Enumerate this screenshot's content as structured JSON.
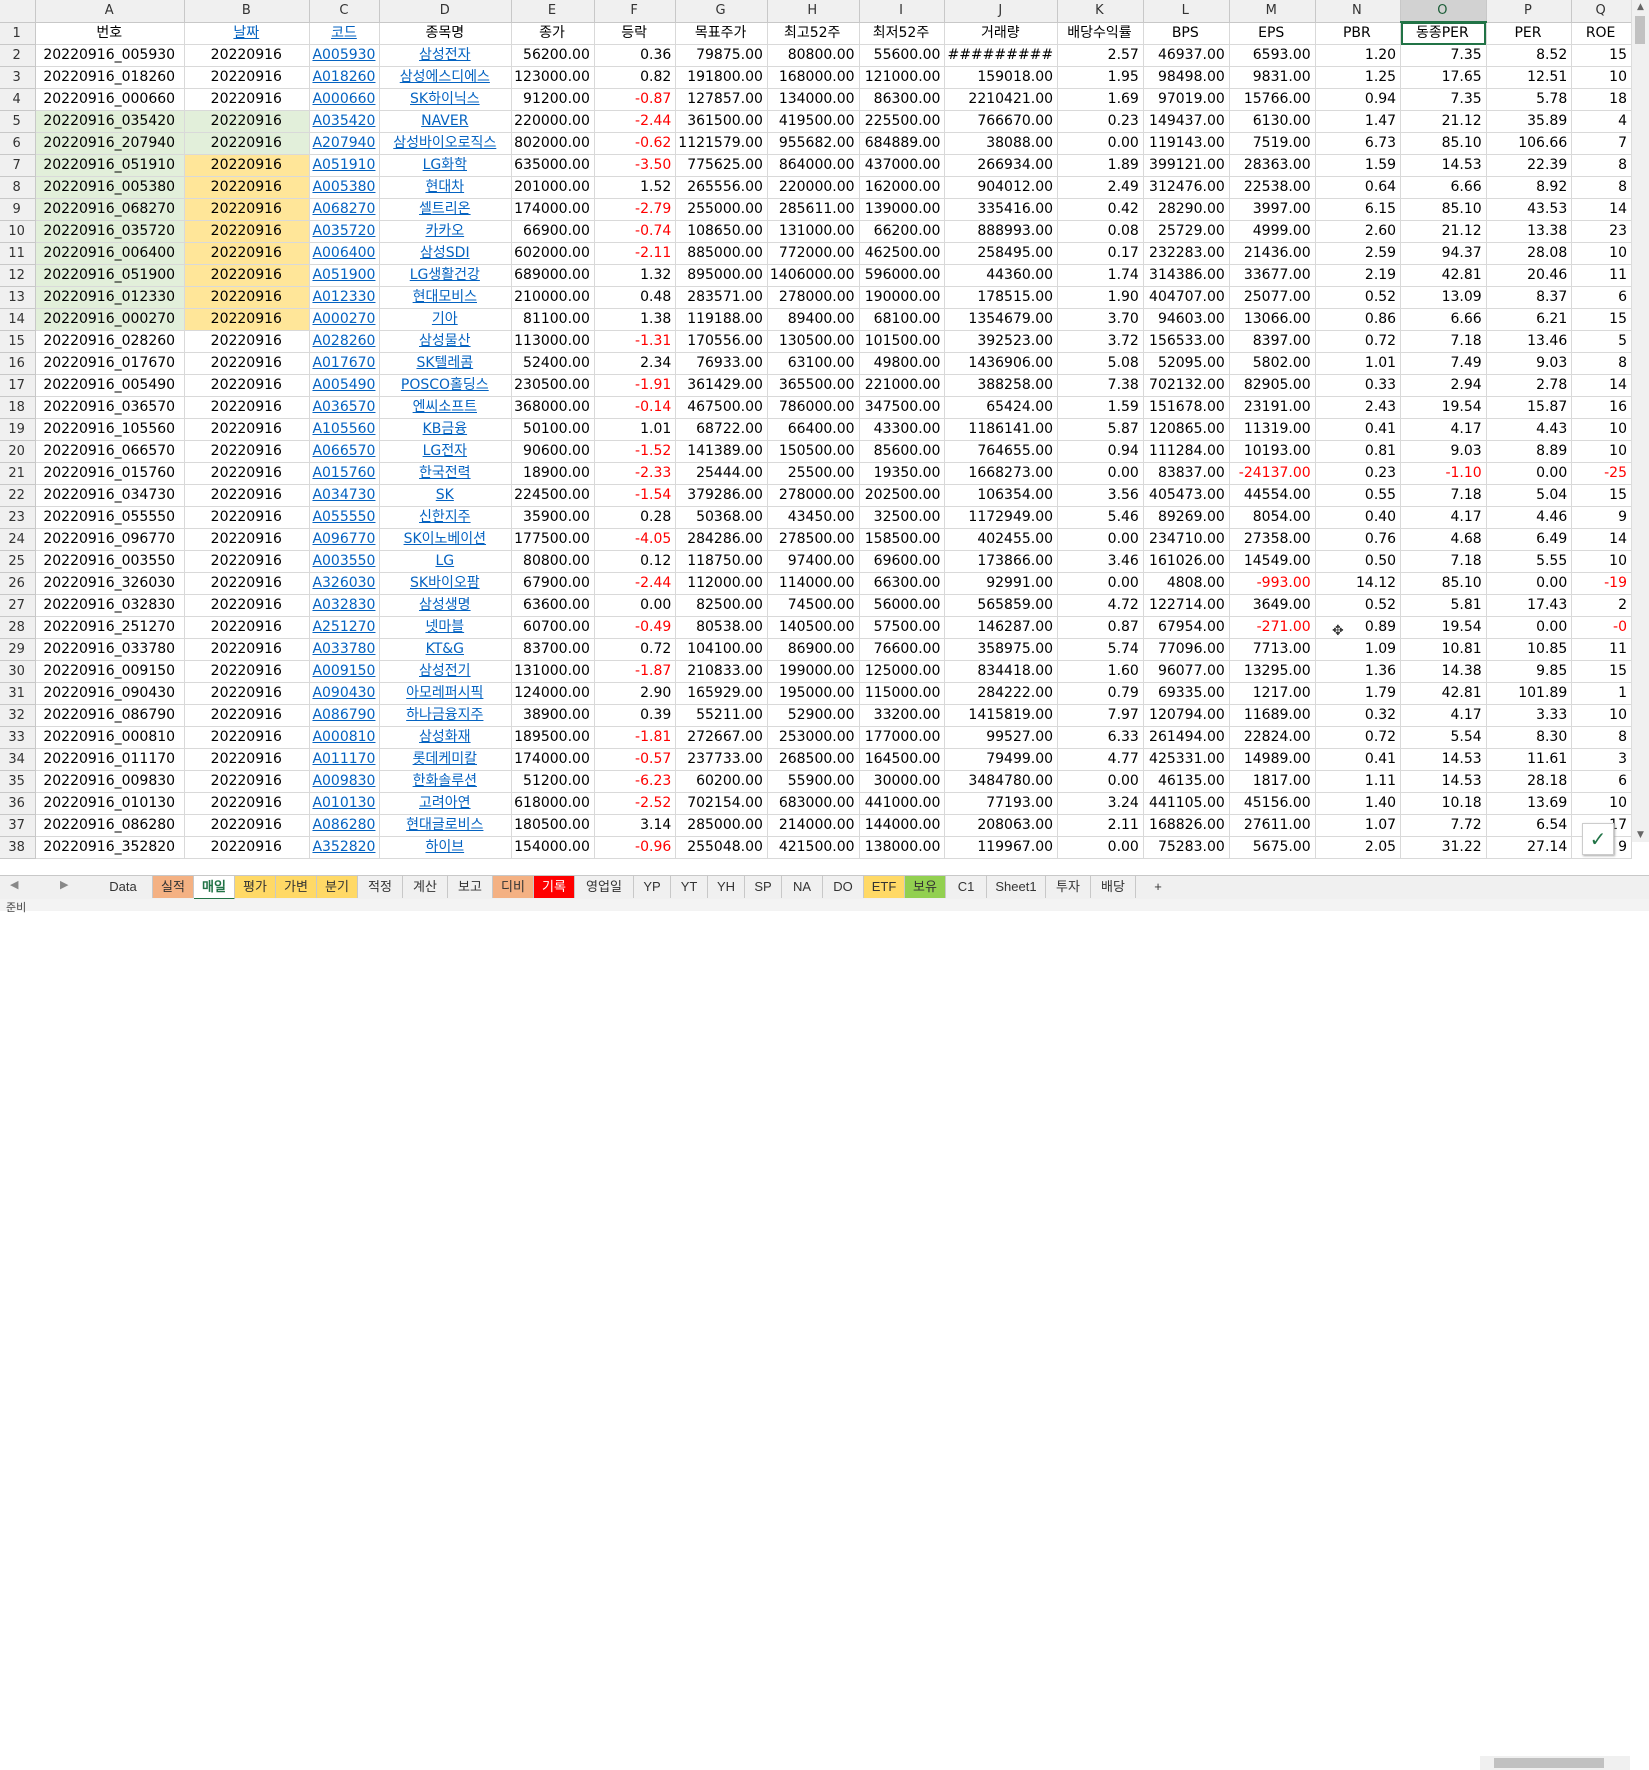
{
  "columns": [
    "A",
    "B",
    "C",
    "D",
    "E",
    "F",
    "G",
    "H",
    "I",
    "J",
    "K",
    "L",
    "M",
    "N",
    "O",
    "P",
    "Q"
  ],
  "header": [
    "번호",
    "날짜",
    "코드",
    "종목명",
    "종가",
    "등락",
    "목표주가",
    "최고52주",
    "최저52주",
    "거래량",
    "배당수익률",
    "BPS",
    "EPS",
    "PBR",
    "동종PER",
    "PER",
    "ROE"
  ],
  "rows": [
    [
      "20220916_005930",
      "20220916",
      "A005930",
      "삼성전자",
      "56200.00",
      "0.36",
      "79875.00",
      "80800.00",
      "55600.00",
      "#########",
      "2.57",
      "46937.00",
      "6593.00",
      "1.20",
      "7.35",
      "8.52",
      "15"
    ],
    [
      "20220916_018260",
      "20220916",
      "A018260",
      "삼성에스디에스",
      "123000.00",
      "0.82",
      "191800.00",
      "168000.00",
      "121000.00",
      "159018.00",
      "1.95",
      "98498.00",
      "9831.00",
      "1.25",
      "17.65",
      "12.51",
      "10"
    ],
    [
      "20220916_000660",
      "20220916",
      "A000660",
      "SK하이닉스",
      "91200.00",
      "-0.87",
      "127857.00",
      "134000.00",
      "86300.00",
      "2210421.00",
      "1.69",
      "97019.00",
      "15766.00",
      "0.94",
      "7.35",
      "5.78",
      "18"
    ],
    [
      "20220916_035420",
      "20220916",
      "A035420",
      "NAVER",
      "220000.00",
      "-2.44",
      "361500.00",
      "419500.00",
      "225500.00",
      "766670.00",
      "0.23",
      "149437.00",
      "6130.00",
      "1.47",
      "21.12",
      "35.89",
      "4"
    ],
    [
      "20220916_207940",
      "20220916",
      "A207940",
      "삼성바이오로직스",
      "802000.00",
      "-0.62",
      "1121579.00",
      "955682.00",
      "684889.00",
      "38088.00",
      "0.00",
      "119143.00",
      "7519.00",
      "6.73",
      "85.10",
      "106.66",
      "7"
    ],
    [
      "20220916_051910",
      "20220916",
      "A051910",
      "LG화학",
      "635000.00",
      "-3.50",
      "775625.00",
      "864000.00",
      "437000.00",
      "266934.00",
      "1.89",
      "399121.00",
      "28363.00",
      "1.59",
      "14.53",
      "22.39",
      "8"
    ],
    [
      "20220916_005380",
      "20220916",
      "A005380",
      "현대차",
      "201000.00",
      "1.52",
      "265556.00",
      "220000.00",
      "162000.00",
      "904012.00",
      "2.49",
      "312476.00",
      "22538.00",
      "0.64",
      "6.66",
      "8.92",
      "8"
    ],
    [
      "20220916_068270",
      "20220916",
      "A068270",
      "셀트리온",
      "174000.00",
      "-2.79",
      "255000.00",
      "285611.00",
      "139000.00",
      "335416.00",
      "0.42",
      "28290.00",
      "3997.00",
      "6.15",
      "85.10",
      "43.53",
      "14"
    ],
    [
      "20220916_035720",
      "20220916",
      "A035720",
      "카카오",
      "66900.00",
      "-0.74",
      "108650.00",
      "131000.00",
      "66200.00",
      "888993.00",
      "0.08",
      "25729.00",
      "4999.00",
      "2.60",
      "21.12",
      "13.38",
      "23"
    ],
    [
      "20220916_006400",
      "20220916",
      "A006400",
      "삼성SDI",
      "602000.00",
      "-2.11",
      "885000.00",
      "772000.00",
      "462500.00",
      "258495.00",
      "0.17",
      "232283.00",
      "21436.00",
      "2.59",
      "94.37",
      "28.08",
      "10"
    ],
    [
      "20220916_051900",
      "20220916",
      "A051900",
      "LG생활건강",
      "689000.00",
      "1.32",
      "895000.00",
      "1406000.00",
      "596000.00",
      "44360.00",
      "1.74",
      "314386.00",
      "33677.00",
      "2.19",
      "42.81",
      "20.46",
      "11"
    ],
    [
      "20220916_012330",
      "20220916",
      "A012330",
      "현대모비스",
      "210000.00",
      "0.48",
      "283571.00",
      "278000.00",
      "190000.00",
      "178515.00",
      "1.90",
      "404707.00",
      "25077.00",
      "0.52",
      "13.09",
      "8.37",
      "6"
    ],
    [
      "20220916_000270",
      "20220916",
      "A000270",
      "기아",
      "81100.00",
      "1.38",
      "119188.00",
      "89400.00",
      "68100.00",
      "1354679.00",
      "3.70",
      "94603.00",
      "13066.00",
      "0.86",
      "6.66",
      "6.21",
      "15"
    ],
    [
      "20220916_028260",
      "20220916",
      "A028260",
      "삼성물산",
      "113000.00",
      "-1.31",
      "170556.00",
      "130500.00",
      "101500.00",
      "392523.00",
      "3.72",
      "156533.00",
      "8397.00",
      "0.72",
      "7.18",
      "13.46",
      "5"
    ],
    [
      "20220916_017670",
      "20220916",
      "A017670",
      "SK텔레콤",
      "52400.00",
      "2.34",
      "76933.00",
      "63100.00",
      "49800.00",
      "1436906.00",
      "5.08",
      "52095.00",
      "5802.00",
      "1.01",
      "7.49",
      "9.03",
      "8"
    ],
    [
      "20220916_005490",
      "20220916",
      "A005490",
      "POSCO홀딩스",
      "230500.00",
      "-1.91",
      "361429.00",
      "365500.00",
      "221000.00",
      "388258.00",
      "7.38",
      "702132.00",
      "82905.00",
      "0.33",
      "2.94",
      "2.78",
      "14"
    ],
    [
      "20220916_036570",
      "20220916",
      "A036570",
      "엔씨소프트",
      "368000.00",
      "-0.14",
      "467500.00",
      "786000.00",
      "347500.00",
      "65424.00",
      "1.59",
      "151678.00",
      "23191.00",
      "2.43",
      "19.54",
      "15.87",
      "16"
    ],
    [
      "20220916_105560",
      "20220916",
      "A105560",
      "KB금융",
      "50100.00",
      "1.01",
      "68722.00",
      "66400.00",
      "43300.00",
      "1186141.00",
      "5.87",
      "120865.00",
      "11319.00",
      "0.41",
      "4.17",
      "4.43",
      "10"
    ],
    [
      "20220916_066570",
      "20220916",
      "A066570",
      "LG전자",
      "90600.00",
      "-1.52",
      "141389.00",
      "150500.00",
      "85600.00",
      "764655.00",
      "0.94",
      "111284.00",
      "10193.00",
      "0.81",
      "9.03",
      "8.89",
      "10"
    ],
    [
      "20220916_015760",
      "20220916",
      "A015760",
      "한국전력",
      "18900.00",
      "-2.33",
      "25444.00",
      "25500.00",
      "19350.00",
      "1668273.00",
      "0.00",
      "83837.00",
      "-24137.00",
      "0.23",
      "-1.10",
      "0.00",
      "-25"
    ],
    [
      "20220916_034730",
      "20220916",
      "A034730",
      "SK",
      "224500.00",
      "-1.54",
      "379286.00",
      "278000.00",
      "202500.00",
      "106354.00",
      "3.56",
      "405473.00",
      "44554.00",
      "0.55",
      "7.18",
      "5.04",
      "15"
    ],
    [
      "20220916_055550",
      "20220916",
      "A055550",
      "신한지주",
      "35900.00",
      "0.28",
      "50368.00",
      "43450.00",
      "32500.00",
      "1172949.00",
      "5.46",
      "89269.00",
      "8054.00",
      "0.40",
      "4.17",
      "4.46",
      "9"
    ],
    [
      "20220916_096770",
      "20220916",
      "A096770",
      "SK이노베이션",
      "177500.00",
      "-4.05",
      "284286.00",
      "278500.00",
      "158500.00",
      "402455.00",
      "0.00",
      "234710.00",
      "27358.00",
      "0.76",
      "4.68",
      "6.49",
      "14"
    ],
    [
      "20220916_003550",
      "20220916",
      "A003550",
      "LG",
      "80800.00",
      "0.12",
      "118750.00",
      "97400.00",
      "69600.00",
      "173866.00",
      "3.46",
      "161026.00",
      "14549.00",
      "0.50",
      "7.18",
      "5.55",
      "10"
    ],
    [
      "20220916_326030",
      "20220916",
      "A326030",
      "SK바이오팜",
      "67900.00",
      "-2.44",
      "112000.00",
      "114000.00",
      "66300.00",
      "92991.00",
      "0.00",
      "4808.00",
      "-993.00",
      "14.12",
      "85.10",
      "0.00",
      "-19"
    ],
    [
      "20220916_032830",
      "20220916",
      "A032830",
      "삼성생명",
      "63600.00",
      "0.00",
      "82500.00",
      "74500.00",
      "56000.00",
      "565859.00",
      "4.72",
      "122714.00",
      "3649.00",
      "0.52",
      "5.81",
      "17.43",
      "2"
    ],
    [
      "20220916_251270",
      "20220916",
      "A251270",
      "넷마블",
      "60700.00",
      "-0.49",
      "80538.00",
      "140500.00",
      "57500.00",
      "146287.00",
      "0.87",
      "67954.00",
      "-271.00",
      "0.89",
      "19.54",
      "0.00",
      "-0"
    ],
    [
      "20220916_033780",
      "20220916",
      "A033780",
      "KT&G",
      "83700.00",
      "0.72",
      "104100.00",
      "86900.00",
      "76600.00",
      "358975.00",
      "5.74",
      "77096.00",
      "7713.00",
      "1.09",
      "10.81",
      "10.85",
      "11"
    ],
    [
      "20220916_009150",
      "20220916",
      "A009150",
      "삼성전기",
      "131000.00",
      "-1.87",
      "210833.00",
      "199000.00",
      "125000.00",
      "834418.00",
      "1.60",
      "96077.00",
      "13295.00",
      "1.36",
      "14.38",
      "9.85",
      "15"
    ],
    [
      "20220916_090430",
      "20220916",
      "A090430",
      "아모레퍼시픽",
      "124000.00",
      "2.90",
      "165929.00",
      "195000.00",
      "115000.00",
      "284222.00",
      "0.79",
      "69335.00",
      "1217.00",
      "1.79",
      "42.81",
      "101.89",
      "1"
    ],
    [
      "20220916_086790",
      "20220916",
      "A086790",
      "하나금융지주",
      "38900.00",
      "0.39",
      "55211.00",
      "52900.00",
      "33200.00",
      "1415819.00",
      "7.97",
      "120794.00",
      "11689.00",
      "0.32",
      "4.17",
      "3.33",
      "10"
    ],
    [
      "20220916_000810",
      "20220916",
      "A000810",
      "삼성화재",
      "189500.00",
      "-1.81",
      "272667.00",
      "253000.00",
      "177000.00",
      "99527.00",
      "6.33",
      "261494.00",
      "22824.00",
      "0.72",
      "5.54",
      "8.30",
      "8"
    ],
    [
      "20220916_011170",
      "20220916",
      "A011170",
      "롯데케미칼",
      "174000.00",
      "-0.57",
      "237733.00",
      "268500.00",
      "164500.00",
      "79499.00",
      "4.77",
      "425331.00",
      "14989.00",
      "0.41",
      "14.53",
      "11.61",
      "3"
    ],
    [
      "20220916_009830",
      "20220916",
      "A009830",
      "한화솔루션",
      "51200.00",
      "-6.23",
      "60200.00",
      "55900.00",
      "30000.00",
      "3484780.00",
      "0.00",
      "46135.00",
      "1817.00",
      "1.11",
      "14.53",
      "28.18",
      "6"
    ],
    [
      "20220916_010130",
      "20220916",
      "A010130",
      "고려아연",
      "618000.00",
      "-2.52",
      "702154.00",
      "683000.00",
      "441000.00",
      "77193.00",
      "3.24",
      "441105.00",
      "45156.00",
      "1.40",
      "10.18",
      "13.69",
      "10"
    ],
    [
      "20220916_086280",
      "20220916",
      "A086280",
      "현대글로비스",
      "180500.00",
      "3.14",
      "285000.00",
      "214000.00",
      "144000.00",
      "208063.00",
      "2.11",
      "168826.00",
      "27611.00",
      "1.07",
      "7.72",
      "6.54",
      "17"
    ],
    [
      "20220916_352820",
      "20220916",
      "A352820",
      "하이브",
      "154000.00",
      "-0.96",
      "255048.00",
      "421500.00",
      "138000.00",
      "119967.00",
      "0.00",
      "75283.00",
      "5675.00",
      "2.05",
      "31.22",
      "27.14",
      "9"
    ]
  ],
  "tabs": [
    {
      "label": "Data",
      "style": ""
    },
    {
      "label": "실적",
      "style": "orange"
    },
    {
      "label": "매일",
      "style": "active"
    },
    {
      "label": "평가",
      "style": "yellow"
    },
    {
      "label": "가변",
      "style": "yellow"
    },
    {
      "label": "분기",
      "style": "yellow"
    },
    {
      "label": "적정",
      "style": ""
    },
    {
      "label": "계산",
      "style": ""
    },
    {
      "label": "보고",
      "style": ""
    },
    {
      "label": "디비",
      "style": "orange"
    },
    {
      "label": "기록",
      "style": "red"
    },
    {
      "label": "영업일",
      "style": ""
    },
    {
      "label": "YP",
      "style": ""
    },
    {
      "label": "YT",
      "style": ""
    },
    {
      "label": "YH",
      "style": ""
    },
    {
      "label": "SP",
      "style": ""
    },
    {
      "label": "NA",
      "style": ""
    },
    {
      "label": "DO",
      "style": ""
    },
    {
      "label": "ETF",
      "style": "yellow"
    },
    {
      "label": "보유",
      "style": "green"
    },
    {
      "label": "C1",
      "style": ""
    },
    {
      "label": "Sheet1",
      "style": ""
    },
    {
      "label": "투자",
      "style": ""
    },
    {
      "label": "배당",
      "style": ""
    }
  ],
  "add_sheet_label": "+",
  "status": {
    "ready": "준비"
  }
}
